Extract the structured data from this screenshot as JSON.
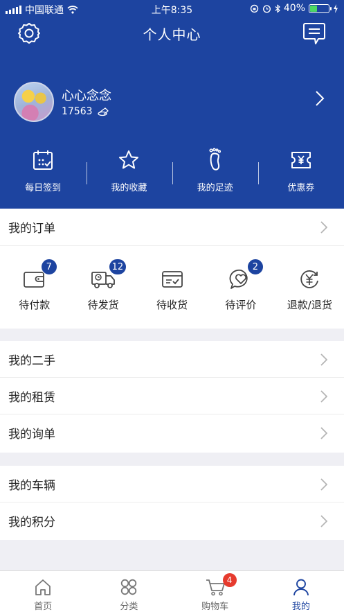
{
  "status_bar": {
    "carrier": "中国联通",
    "time": "上午8:35",
    "battery": "40%",
    "battery_level": 0.4
  },
  "nav": {
    "title": "个人中心",
    "left_icon": "gear-icon",
    "right_icon": "message-icon"
  },
  "profile": {
    "name": "心心念念",
    "points": "17563"
  },
  "quick_actions": [
    {
      "label": "每日签到",
      "icon": "calendar-icon"
    },
    {
      "label": "我的收藏",
      "icon": "star-icon"
    },
    {
      "label": "我的足迹",
      "icon": "footprint-icon"
    },
    {
      "label": "优惠券",
      "icon": "coupon-icon"
    }
  ],
  "orders": {
    "title": "我的订单",
    "statuses": [
      {
        "label": "待付款",
        "badge": "7",
        "icon": "wallet-icon"
      },
      {
        "label": "待发货",
        "badge": "12",
        "icon": "truck-icon"
      },
      {
        "label": "待收货",
        "badge": "",
        "icon": "receipt-box-icon"
      },
      {
        "label": "待评价",
        "badge": "2",
        "icon": "heart-chat-icon"
      },
      {
        "label": "退款/退货",
        "badge": "",
        "icon": "refund-icon"
      }
    ]
  },
  "menu_group_1": [
    "我的二手",
    "我的租赁",
    "我的询单"
  ],
  "menu_group_2": [
    "我的车辆",
    "我的积分"
  ],
  "tabbar": {
    "items": [
      {
        "label": "首页",
        "icon": "home-icon"
      },
      {
        "label": "分类",
        "icon": "category-icon"
      },
      {
        "label": "购物车",
        "icon": "cart-icon",
        "badge": "4"
      },
      {
        "label": "我的",
        "icon": "user-icon",
        "active": true
      }
    ]
  },
  "colors": {
    "primary": "#1d44a0",
    "badge_red": "#e63b2e",
    "background": "#efeff4"
  }
}
